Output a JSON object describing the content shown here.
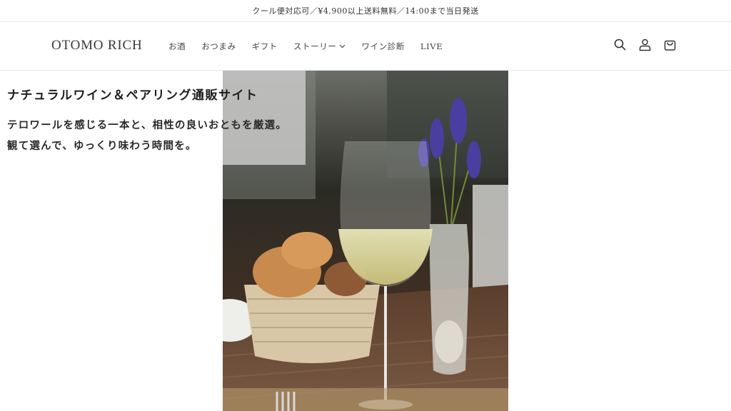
{
  "announcement": {
    "text": "クール便対応可／¥4,900以上送料無料／14:00まで当日発送"
  },
  "header": {
    "logo": "OTOMO RICH",
    "nav": [
      {
        "label": "お酒"
      },
      {
        "label": "おつまみ"
      },
      {
        "label": "ギフト"
      },
      {
        "label": "ストーリー"
      },
      {
        "label": "ワイン診断"
      },
      {
        "label": "LIVE"
      }
    ],
    "icons": [
      "search-icon",
      "account-icon",
      "cart-icon"
    ]
  },
  "hero": {
    "title": "ナチュラルワイン＆ペアリング通販サイト",
    "subtitle_line1": "テロワールを感じる一本と、相性の良いおともを厳選。",
    "subtitle_line2": "観て選んで、ゆっくり味わう時間を。"
  },
  "colors": {
    "text": "#222222",
    "panel": "#c8c8c8",
    "border": "#e6e6e6"
  }
}
